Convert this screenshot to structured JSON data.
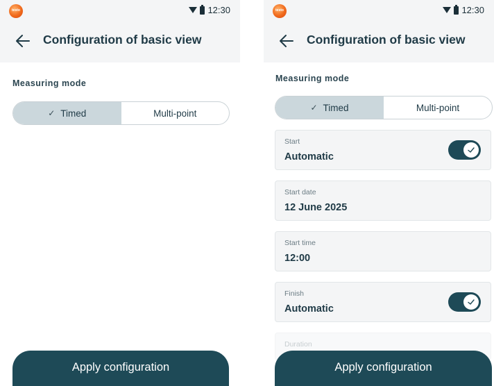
{
  "colors": {
    "primary": "#1e4a57",
    "segment_active": "#cbd7dc",
    "appbar_bg": "#f4f5f6",
    "logo": "#f06a1c"
  },
  "icons": {
    "logo": "testo-logo",
    "back": "arrow-left-icon",
    "wifi": "wifi-icon",
    "battery": "battery-icon",
    "check": "check-icon"
  },
  "left": {
    "status": {
      "logo_text": "testo",
      "time": "12:30"
    },
    "header": {
      "title": "Configuration of basic view"
    },
    "measuring_mode": {
      "label": "Measuring mode",
      "options": [
        {
          "label": "Timed",
          "check": "✓",
          "selected": true
        },
        {
          "label": "Multi-point",
          "selected": false
        }
      ]
    },
    "apply_label": "Apply configuration"
  },
  "right": {
    "status": {
      "logo_text": "testo",
      "time": "12:30"
    },
    "header": {
      "title": "Configuration of basic view"
    },
    "measuring_mode": {
      "label": "Measuring mode",
      "options": [
        {
          "label": "Timed",
          "check": "✓",
          "selected": true
        },
        {
          "label": "Multi-point",
          "selected": false
        }
      ]
    },
    "fields": [
      {
        "label": "Start",
        "value": "Automatic",
        "toggle": true
      },
      {
        "label": "Start date",
        "value": "12 June 2025"
      },
      {
        "label": "Start time",
        "value": "12:00"
      },
      {
        "label": "Finish",
        "value": "Automatic",
        "toggle": true
      },
      {
        "label": "Duration"
      }
    ],
    "apply_label": "Apply configuration"
  }
}
